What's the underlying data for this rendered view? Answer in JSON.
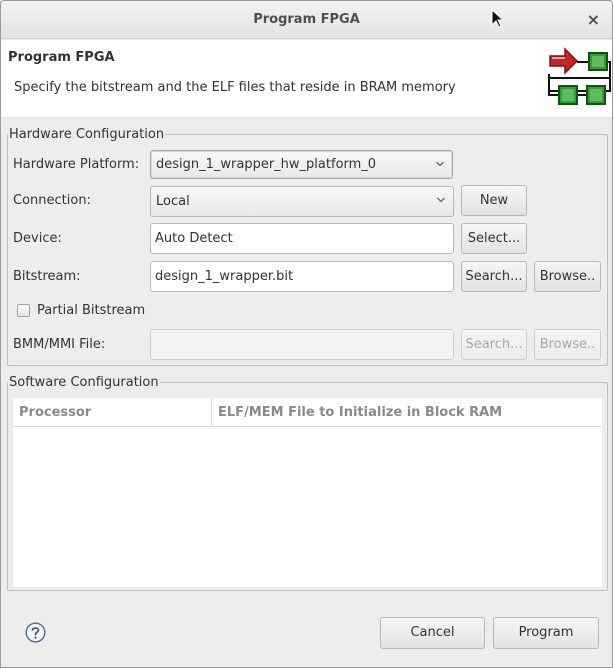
{
  "window": {
    "title": "Program FPGA",
    "close_label": "×"
  },
  "header": {
    "title": "Program FPGA",
    "description": "Specify the bitstream and the ELF files that reside in BRAM memory",
    "logo_icon": "fpga-program-icon"
  },
  "hardware": {
    "legend": "Hardware Configuration",
    "platform_label": "Hardware Platform:",
    "platform_value": "design_1_wrapper_hw_platform_0",
    "connection_label": "Connection:",
    "connection_value": "Local",
    "new_button": "New",
    "device_label": "Device:",
    "device_value": "Auto Detect",
    "select_button": "Select...",
    "bitstream_label": "Bitstream:",
    "bitstream_value": "design_1_wrapper.bit",
    "bitstream_search_button": "Search...",
    "bitstream_browse_button": "Browse..",
    "partial_label": "Partial Bitstream",
    "partial_checked": false,
    "bmm_label": "BMM/MMI File:",
    "bmm_value": "",
    "bmm_search_button": "Search...",
    "bmm_browse_button": "Browse.."
  },
  "software": {
    "legend": "Software Configuration",
    "columns": [
      "Processor",
      "ELF/MEM File to Initialize in Block RAM"
    ],
    "rows": []
  },
  "footer": {
    "help_icon": "help-icon",
    "cancel_button": "Cancel",
    "program_button": "Program"
  },
  "colors": {
    "arrow": "#c0272d",
    "chip": "#2e8b2e",
    "background": "#ededed"
  }
}
